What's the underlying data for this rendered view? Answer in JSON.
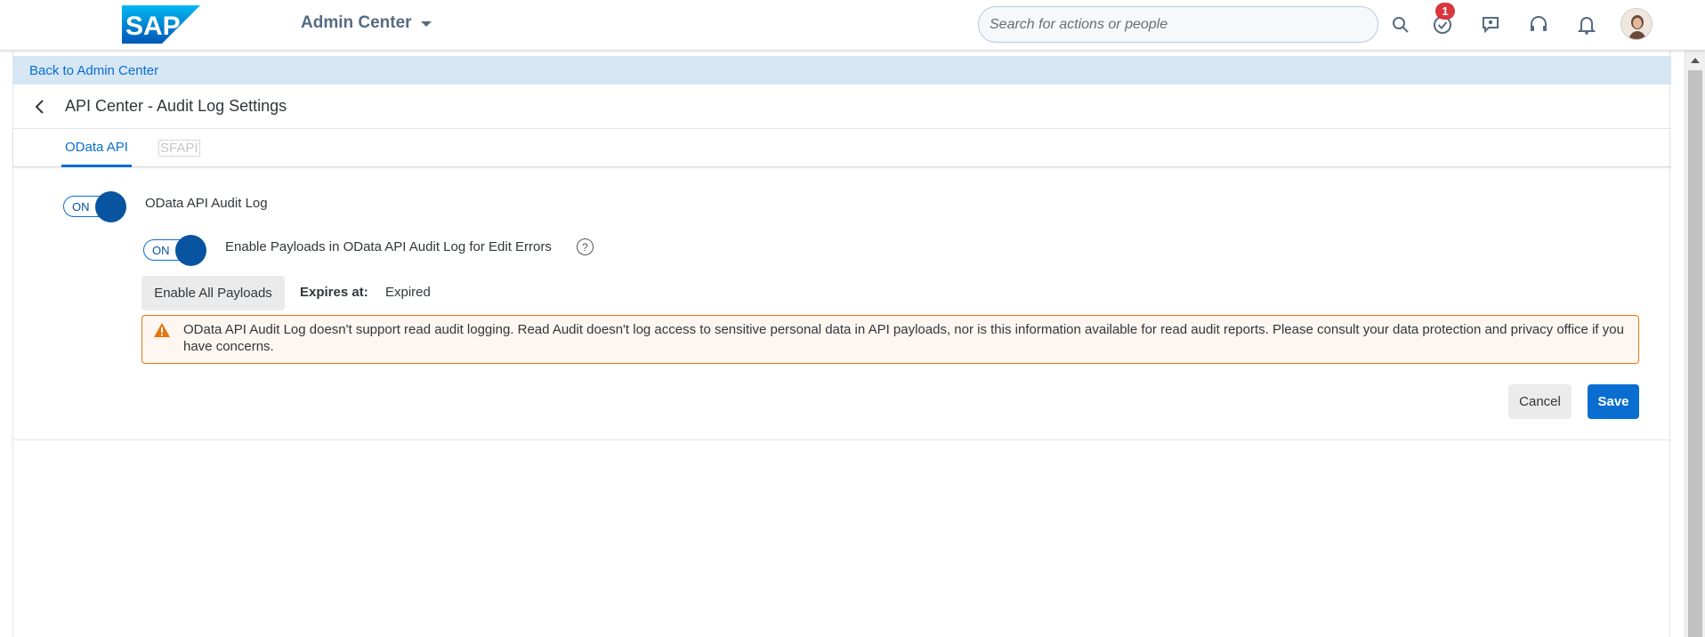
{
  "header": {
    "logo_text": "SAP",
    "app_title": "Admin Center",
    "search_placeholder": "Search for actions or people",
    "notification_badge": "1",
    "icons": [
      "search-icon",
      "task-check-icon",
      "people-chat-icon",
      "headset-icon",
      "bell-icon",
      "avatar"
    ]
  },
  "nav": {
    "back_link": "Back to Admin Center",
    "page_title": "API Center - Audit Log Settings"
  },
  "tabs": [
    {
      "label": "OData API",
      "selected": true
    },
    {
      "label": "SFAPI",
      "selected": false
    }
  ],
  "settings": {
    "audit_log_toggle": "ON",
    "audit_log_label": "OData API Audit Log",
    "payload_toggle": "ON",
    "payload_label": "Enable Payloads in OData API Audit Log for Edit Errors",
    "help_glyph": "?",
    "enable_all_button": "Enable All Payloads",
    "expires_label": "Expires at:",
    "expires_value": "Expired"
  },
  "warning": {
    "text": "OData API Audit Log doesn't support read audit logging. Read Audit doesn't log access to sensitive personal data in API payloads, nor is this information available for read audit reports. Please consult your data protection and privacy office if you have concerns."
  },
  "actions": {
    "cancel": "Cancel",
    "save": "Save"
  },
  "colors": {
    "accent": "#0a6ed1",
    "toggle_knob": "#0854a0",
    "warning_border": "#e9730c",
    "badge": "#d9363e"
  }
}
